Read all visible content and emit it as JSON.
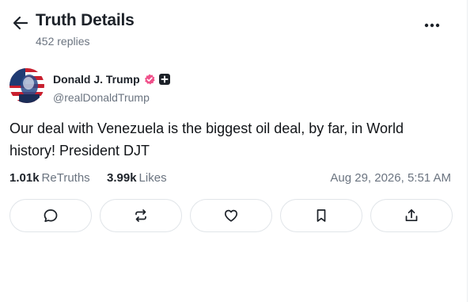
{
  "header": {
    "title": "Truth Details",
    "subtitle": "452 replies",
    "back_icon": "arrow-left-icon",
    "more_icon": "more-horizontal-icon"
  },
  "post": {
    "author": {
      "name": "Donald J. Trump",
      "handle": "@realDonaldTrump",
      "verified_icon": "verified-badge-icon",
      "plus_icon": "plus-badge-icon",
      "verified_color": "#f0508a"
    },
    "text": "Our deal with Venezuela is the biggest oil deal, by far, in World history! President DJT",
    "stats": {
      "retruths_count": "1.01k",
      "retruths_label": "ReTruths",
      "likes_count": "3.99k",
      "likes_label": "Likes"
    },
    "timestamp": "Aug 29, 2026, 5:51 AM"
  },
  "actions": [
    {
      "icon": "reply-icon"
    },
    {
      "icon": "retruth-icon"
    },
    {
      "icon": "like-icon"
    },
    {
      "icon": "bookmark-icon"
    },
    {
      "icon": "share-icon"
    }
  ]
}
